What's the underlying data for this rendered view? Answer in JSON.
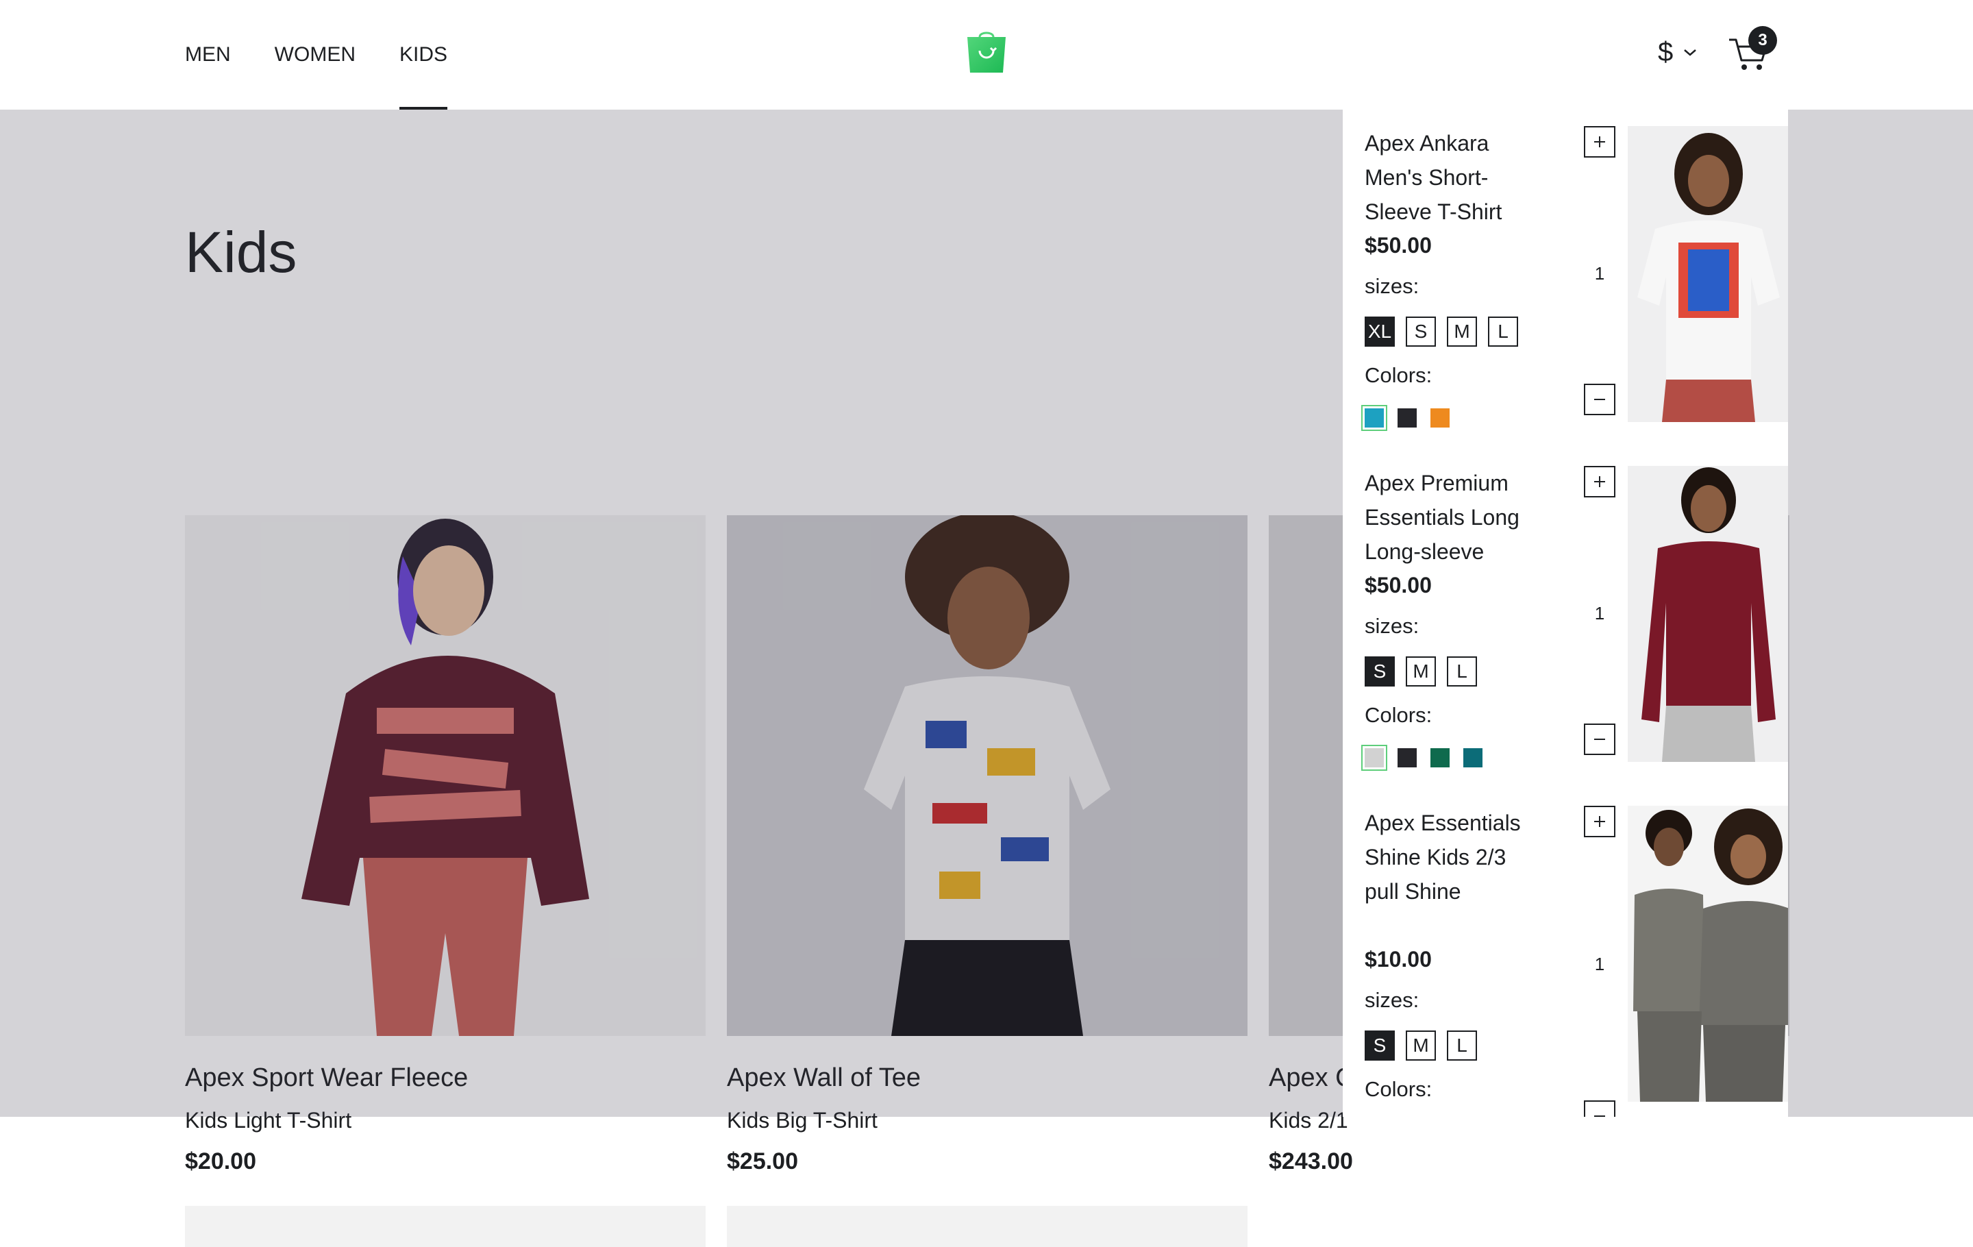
{
  "header": {
    "nav": [
      "MEN",
      "WOMEN",
      "KIDS"
    ],
    "active_nav": "KIDS",
    "currency_symbol": "$",
    "cart_count": "3"
  },
  "category": {
    "title": "Kids"
  },
  "products": [
    {
      "name": "Apex Sport Wear Fleece",
      "subtitle": "Kids Light T-Shirt",
      "price": "$20.00"
    },
    {
      "name": "Apex Wall of Tee",
      "subtitle": "Kids Big T-Shirt",
      "price": "$25.00"
    },
    {
      "name": "Apex C",
      "subtitle": "Kids 2/1",
      "price": "$243.00"
    }
  ],
  "cart": {
    "sizes_label": "sizes:",
    "colors_label": "Colors:",
    "items": [
      {
        "name": "Apex Ankara Men's Short-Sleeve T-Shirt",
        "price": "$50.00",
        "quantity": "1",
        "sizes": [
          "XL",
          "S",
          "M",
          "L"
        ],
        "selected_size": "XL",
        "colors": [
          "#1da1c1",
          "#26262b",
          "#ee8a1f"
        ],
        "selected_color": "#1da1c1"
      },
      {
        "name": "Apex Premium Essentials Long Long-sleeve",
        "price": "$50.00",
        "quantity": "1",
        "sizes": [
          "S",
          "M",
          "L"
        ],
        "selected_size": "S",
        "colors": [
          "#d2d2d2",
          "#26262b",
          "#0f6a4d",
          "#0c6c78"
        ],
        "selected_color": "#d2d2d2"
      },
      {
        "name": "Apex Essentials Shine Kids 2/3 pull Shine",
        "price": "$10.00",
        "quantity": "1",
        "sizes": [
          "S",
          "M",
          "L"
        ],
        "selected_size": "S",
        "colors": [
          "#2e9a5a",
          "#ee8a1f",
          "#1da1c1"
        ],
        "selected_color": "#2e9a5a"
      }
    ]
  },
  "icons": {
    "logo": "shopping-bag-icon",
    "cart": "cart-icon",
    "currency": "chevron-down-icon",
    "increase": "plus-icon",
    "decrease": "minus-icon"
  },
  "colors": {
    "accent": "#5ece7b",
    "text": "#1d1f22",
    "overlay": "#393748"
  }
}
